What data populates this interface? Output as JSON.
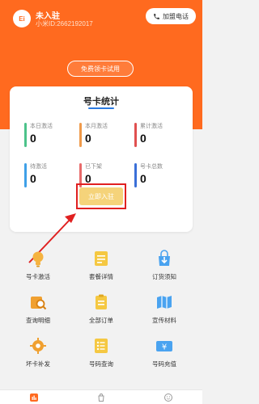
{
  "header": {
    "avatar_text": "Ei",
    "user_name": "未入驻",
    "user_id": "小米ID:2662192017",
    "join_label": "加盟电话",
    "trial_label": "免费领卡试用"
  },
  "stats_card": {
    "title": "号卡统计",
    "stats": [
      {
        "label": "本日激活",
        "value": "0",
        "color": "#4cc28a"
      },
      {
        "label": "本月激活",
        "value": "0",
        "color": "#f09a4a"
      },
      {
        "label": "累计激活",
        "value": "0",
        "color": "#e05050"
      },
      {
        "label": "待激活",
        "value": "0",
        "color": "#3fa0e8"
      },
      {
        "label": "已下架",
        "value": "0",
        "color": "#e86a6a"
      },
      {
        "label": "号卡总数",
        "value": "0",
        "color": "#3a6fd8"
      }
    ],
    "enter_label": "立即入驻"
  },
  "menu": {
    "items": [
      {
        "label": "号卡激活",
        "icon": "lightbulb-icon",
        "color": "#f5b340"
      },
      {
        "label": "套餐详情",
        "icon": "document-icon",
        "color": "#f5c842"
      },
      {
        "label": "订货须知",
        "icon": "download-icon",
        "color": "#4aa3f0"
      },
      {
        "label": "查询明细",
        "icon": "search-icon",
        "color": "#f0a030"
      },
      {
        "label": "全部订单",
        "icon": "clipboard-icon",
        "color": "#f5c842"
      },
      {
        "label": "宣传材料",
        "icon": "map-icon",
        "color": "#4aa3f0"
      },
      {
        "label": "坏卡补发",
        "icon": "gear-icon",
        "color": "#f0a030"
      },
      {
        "label": "号码查询",
        "icon": "list-icon",
        "color": "#f5c842"
      },
      {
        "label": "号码充值",
        "icon": "yen-card-icon",
        "color": "#4aa3f0"
      }
    ]
  },
  "tabbar": {
    "tabs": [
      {
        "icon": "home-icon",
        "active": true
      },
      {
        "icon": "bag-icon",
        "active": false
      },
      {
        "icon": "profile-icon",
        "active": false
      }
    ]
  },
  "colors": {
    "brand": "#ff6a1f",
    "highlight": "#e02020",
    "button": "#f5d37a"
  }
}
